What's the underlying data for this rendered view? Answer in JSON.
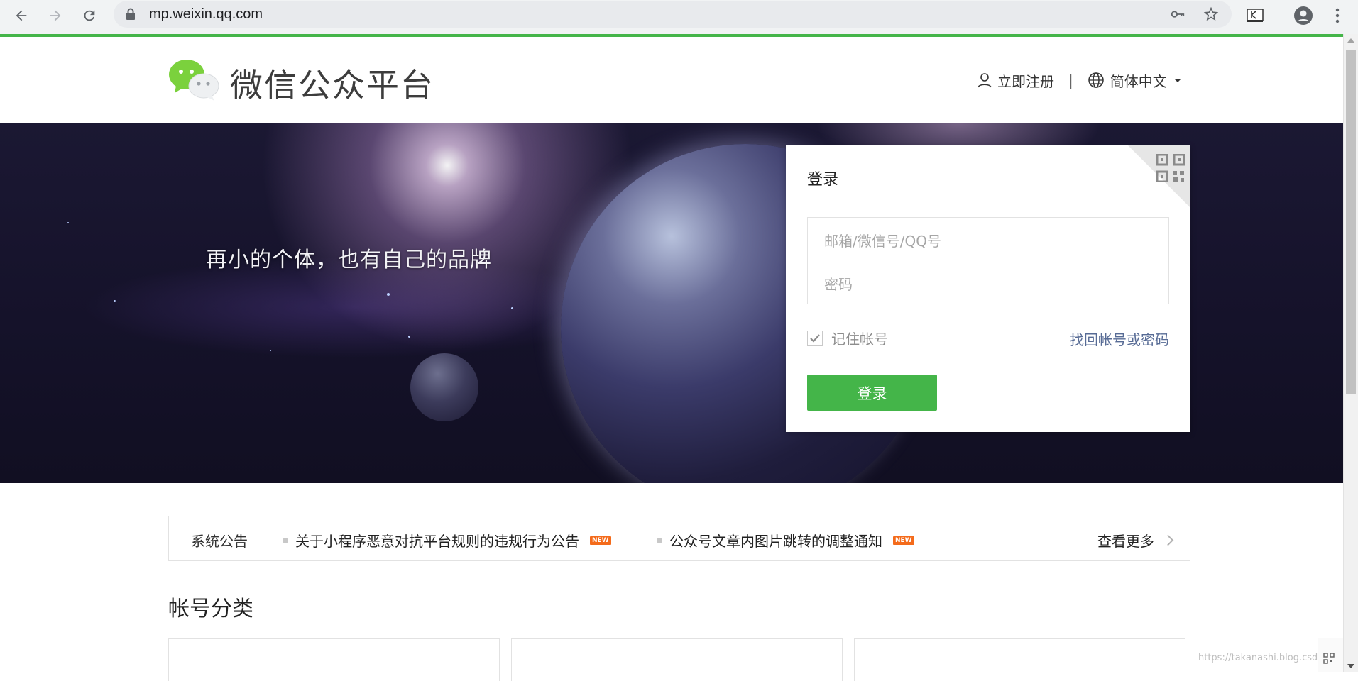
{
  "browser": {
    "url": "mp.weixin.qq.com"
  },
  "header": {
    "brand": "微信公众平台",
    "register_label": "立即注册",
    "separator": "|",
    "language_label": "简体中文"
  },
  "hero": {
    "slogan": "再小的个体，也有自己的品牌"
  },
  "login": {
    "title": "登录",
    "account_placeholder": "邮箱/微信号/QQ号",
    "password_placeholder": "密码",
    "remember_label": "记住帐号",
    "remember_checked": true,
    "forgot_label": "找回帐号或密码",
    "submit_label": "登录"
  },
  "notice": {
    "label": "系统公告",
    "items": [
      {
        "text": "关于小程序恶意对抗平台规则的违规行为公告",
        "badge": "NEW"
      },
      {
        "text": "公众号文章内图片跳转的调整通知",
        "badge": "NEW"
      }
    ],
    "more_label": "查看更多"
  },
  "section": {
    "title": "帐号分类"
  },
  "watermark": "https://takanashi.blog.csdn.net",
  "colors": {
    "brand_green": "#44b549",
    "link_blue": "#576b95",
    "badge_orange": "#f46b1b"
  },
  "icons": {
    "back": "arrow-left-icon",
    "forward": "arrow-right-icon",
    "reload": "reload-icon",
    "lock": "lock-icon",
    "key": "key-icon",
    "star": "star-icon",
    "extension": "extension-icon",
    "profile": "account-circle-icon",
    "menu": "more-vert-icon",
    "user": "user-icon",
    "globe": "globe-icon",
    "qr": "qr-code-icon"
  }
}
